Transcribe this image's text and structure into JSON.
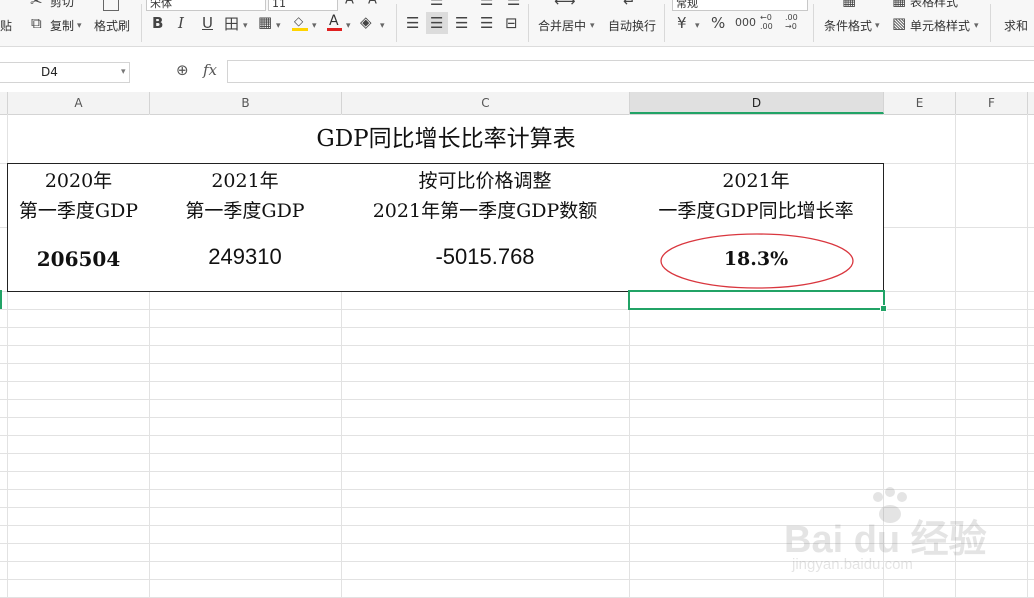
{
  "ribbon": {
    "clipboard": {
      "paste_label": "贴",
      "cut_label": "剪切",
      "copy_label": "复制",
      "format_painter_label": "格式刷"
    },
    "font": {
      "family_value": "宋体",
      "size_value": "11",
      "bold": "B",
      "italic": "I",
      "underline": "U",
      "border_icon": "田",
      "font_color_letter": "A",
      "font_color": "#e02020",
      "fill_color": "#ffd400"
    },
    "align": {
      "merge_center_label": "合并居中",
      "wrap_text_label": "自动换行"
    },
    "number": {
      "format_value": "常规",
      "currency": "¥",
      "percent": "%",
      "thousands": "000",
      "inc_decimal": "←0 .00",
      "dec_decimal": ".00 →0"
    },
    "styles": {
      "cond_format_label": "条件格式",
      "table_style_label": "表格样式",
      "cell_style_label": "单元格样式"
    },
    "sum_label": "求和"
  },
  "formula_bar": {
    "name_box": "D4",
    "fx_label": "fx",
    "formula_value": ""
  },
  "columns": [
    "A",
    "B",
    "C",
    "D",
    "E",
    "F"
  ],
  "selected_column": "D",
  "sheet": {
    "title": "GDP同比增长比率计算表",
    "headers": [
      [
        "2020年",
        "第一季度GDP"
      ],
      [
        "2021年",
        "第一季度GDP"
      ],
      [
        "按可比价格调整",
        "2021年第一季度GDP数额"
      ],
      [
        "2021年",
        "一季度GDP同比增长率"
      ]
    ],
    "values": [
      "206504",
      "249310",
      "-5015.768",
      "18.3%"
    ],
    "highlight_color": "#d9363e",
    "selection_color": "#21a366"
  },
  "watermark": {
    "logo_text": "Bai  du 经验",
    "url": "jingyan.baidu.com"
  }
}
